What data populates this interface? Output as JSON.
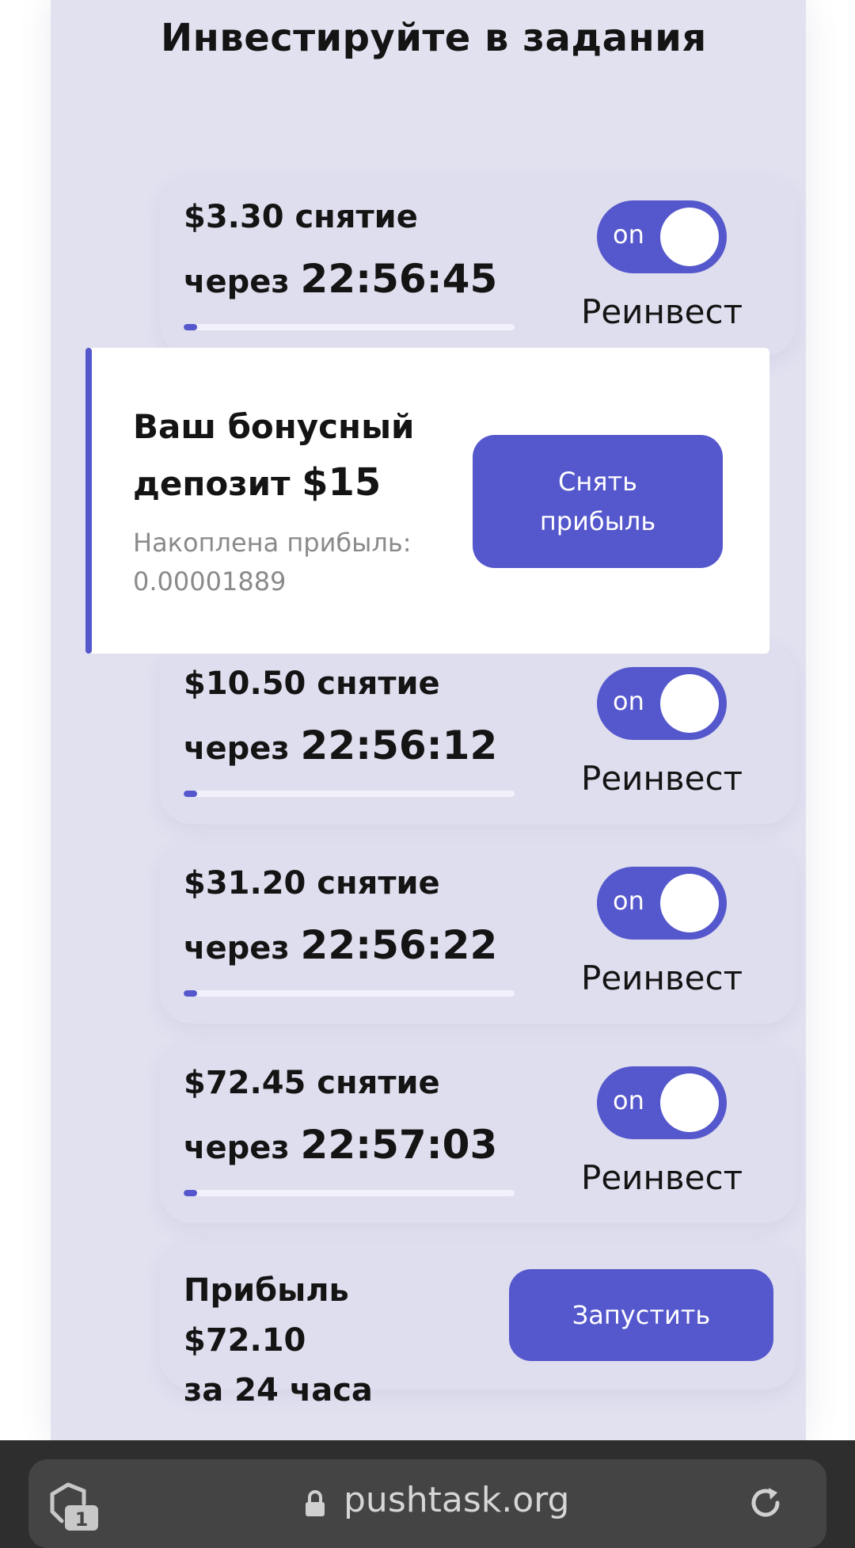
{
  "page_title": "Инвестируйте в задания",
  "colors": {
    "accent": "#5557cc",
    "panel_bg": "#e2e1f0",
    "card_bg": "#dfdeee",
    "browser_bar": "#2e2e2e"
  },
  "tasks": [
    {
      "amount_text": "$3.30 снятие",
      "timer_prefix": "через",
      "timer": "22:56:45",
      "progress": 0.04,
      "toggle_text": "on",
      "toggle_label": "Реинвест"
    },
    {
      "amount_text": "$10.50 снятие",
      "timer_prefix": "через",
      "timer": "22:56:12",
      "progress": 0.04,
      "toggle_text": "on",
      "toggle_label": "Реинвест"
    },
    {
      "amount_text": "$31.20 снятие",
      "timer_prefix": "через",
      "timer": "22:56:22",
      "progress": 0.04,
      "toggle_text": "on",
      "toggle_label": "Реинвест"
    },
    {
      "amount_text": "$72.45 снятие",
      "timer_prefix": "через",
      "timer": "22:57:03",
      "progress": 0.04,
      "toggle_text": "on",
      "toggle_label": "Реинвест"
    }
  ],
  "bonus": {
    "title_part1": "Ваш бонусный депозит",
    "title_amount": "$15",
    "accrued_label": "Накоплена прибыль:",
    "accrued_value": "0.00001889",
    "button_line1": "Снять",
    "button_line2": "прибыль"
  },
  "profit": {
    "text_line1": "Прибыль $72.10",
    "text_line2": "за 24 часа",
    "button_label": "Запустить"
  },
  "browser": {
    "tab_count": "1",
    "url": "pushtask.org",
    "icons": [
      "tabs-icon",
      "lock-icon",
      "reload-icon"
    ]
  }
}
